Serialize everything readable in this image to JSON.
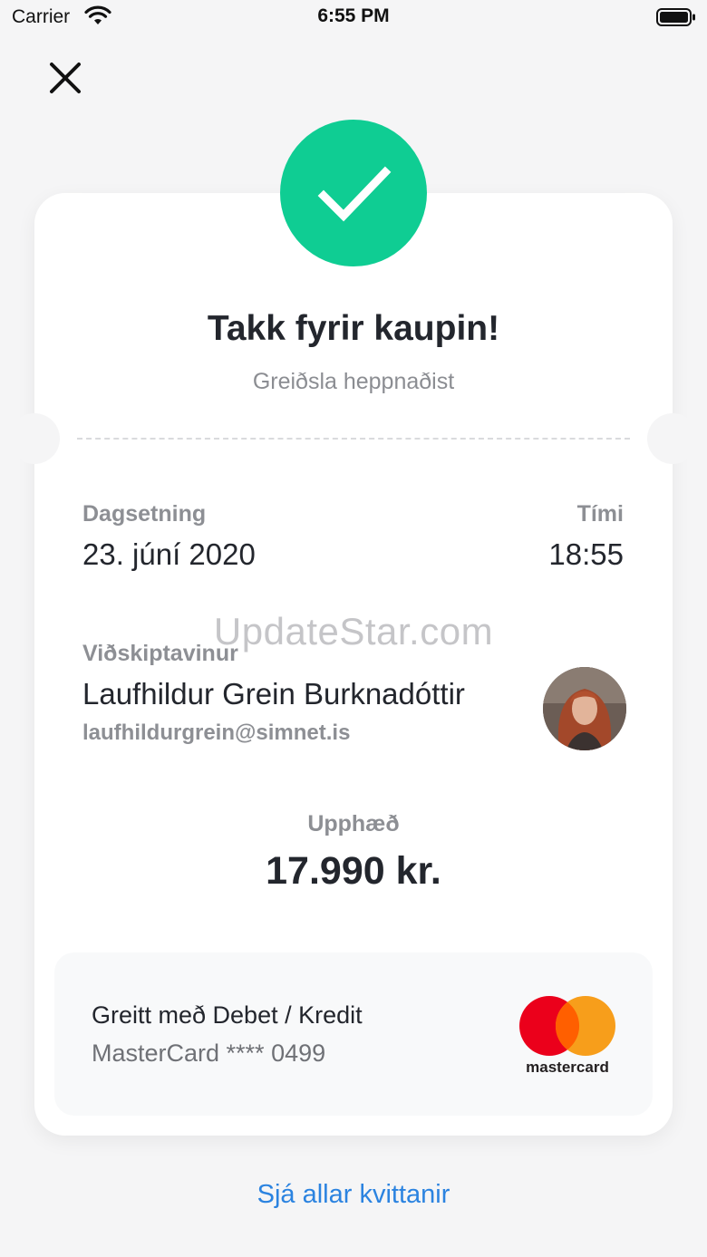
{
  "status_bar": {
    "carrier": "Carrier",
    "time": "6:55 PM"
  },
  "icons": {
    "close": "close-icon",
    "check": "checkmark-icon",
    "wifi": "wifi-icon",
    "battery": "battery-icon"
  },
  "colors": {
    "success": "#0fcd93",
    "link": "#2b83e0",
    "mastercard_red": "#eb001b",
    "mastercard_orange": "#f79e1b"
  },
  "receipt": {
    "title": "Takk fyrir kaupin!",
    "subtitle": "Greiðsla heppnaðist",
    "date_label": "Dagsetning",
    "date_value": "23. júní 2020",
    "time_label": "Tími",
    "time_value": "18:55",
    "customer_label": "Viðskiptavinur",
    "customer_name": "Laufhildur Grein Burknadóttir",
    "customer_email": "laufhildurgrein@simnet.is",
    "amount_label": "Upphæð",
    "amount_value": "17.990 kr."
  },
  "payment": {
    "title": "Greitt með Debet / Kredit",
    "card": "MasterCard **** 0499",
    "brand_logo_text": "mastercard"
  },
  "watermark": "UpdateStar.com",
  "footer": {
    "receipts_link": "Sjá allar kvittanir"
  }
}
